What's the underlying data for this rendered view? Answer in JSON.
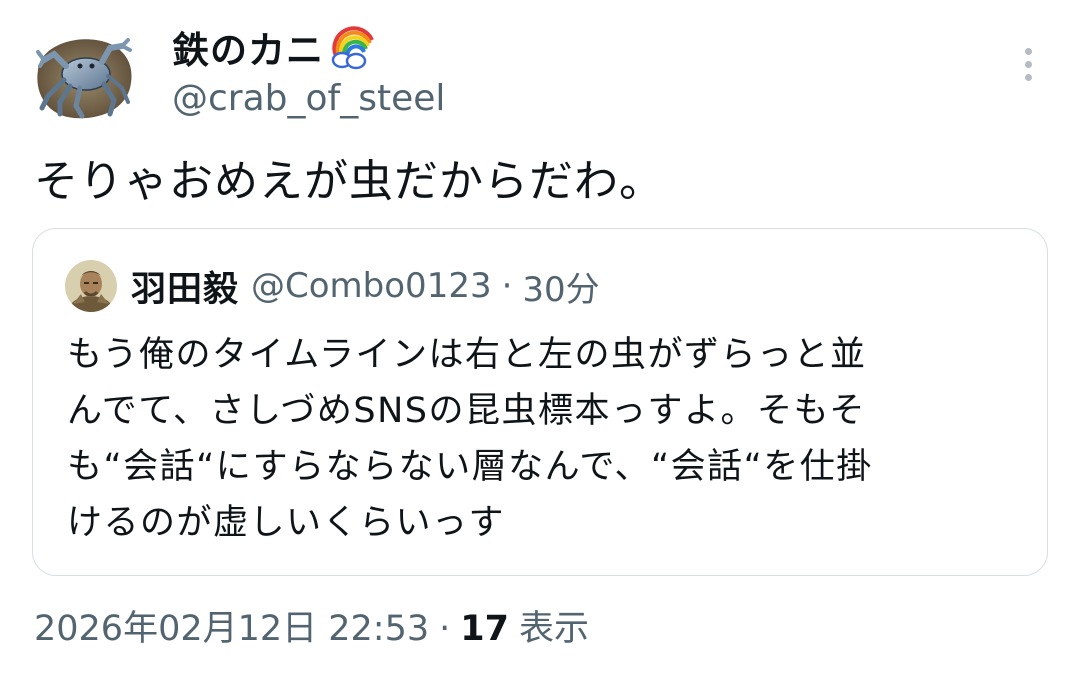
{
  "author": {
    "display_name": "鉄のカニ",
    "name_emoji": "rainbow-icon",
    "handle": "@crab_of_steel",
    "avatar": "crab-avatar"
  },
  "more_menu": {
    "icon": "more-vertical-icon"
  },
  "tweet": {
    "text": "そりゃおめえが虫だからだわ。"
  },
  "quoted_tweet": {
    "display_name": "羽田毅",
    "handle": "@Combo0123",
    "separator": "·",
    "time_ago": "30分",
    "avatar": "warrior-avatar",
    "text_lines": [
      "もう俺のタイムラインは右と左の虫がずらっと並",
      "んでて、さしづめSNSの昆虫標本っすよ。そもそ",
      "も“会話“にすらならない層なんで、“会話“を仕掛",
      "けるのが虚しいくらいっす"
    ]
  },
  "meta": {
    "timestamp": "2026年02月12日 22:53",
    "separator": "·",
    "views_count": "17",
    "views_label": "表示"
  },
  "colors": {
    "text_primary": "#0f1419",
    "text_secondary": "#536471",
    "border": "#d8dee3",
    "background": "#ffffff"
  }
}
